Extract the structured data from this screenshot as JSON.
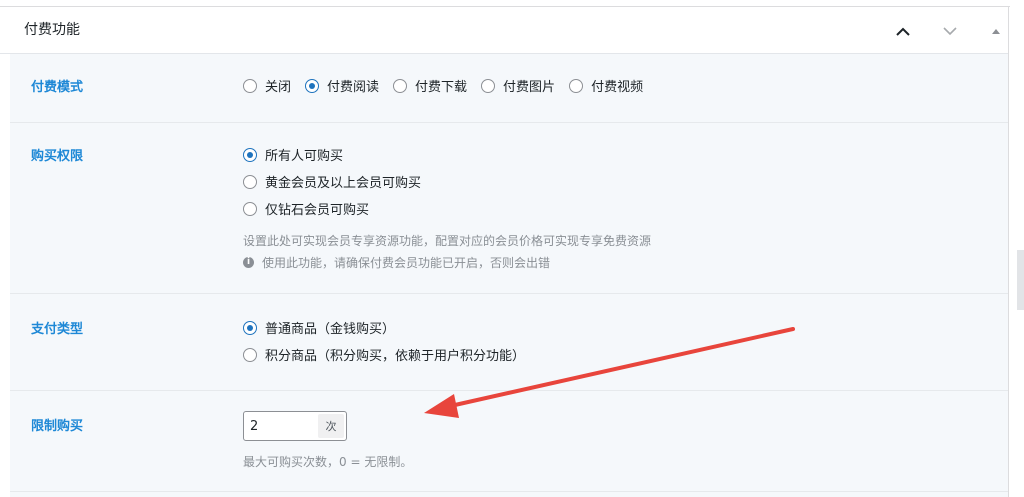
{
  "panel": {
    "title": "付费功能",
    "icons": [
      "chevron-up-icon",
      "chevron-down-icon",
      "triangle-up-icon"
    ],
    "colors": {
      "label": "#1e88d6",
      "radio_checked": "#1e73be",
      "background": "#f5f8fb",
      "annotation_arrow": "#e8453c"
    }
  },
  "pay_mode": {
    "label": "付费模式",
    "options": [
      "关闭",
      "付费阅读",
      "付费下载",
      "付费图片",
      "付费视频"
    ],
    "selected": "付费阅读"
  },
  "purchase_permission": {
    "label": "购买权限",
    "options": [
      "所有人可购买",
      "黄金会员及以上会员可购买",
      "仅钻石会员可购买"
    ],
    "selected": "所有人可购买",
    "description": "设置此处可实现会员专享资源功能，配置对应的会员价格可实现专享免费资源",
    "notice": "使用此功能，请确保付费会员功能已开启，否则会出错"
  },
  "payment_type": {
    "label": "支付类型",
    "options": [
      "普通商品（金钱购买）",
      "积分商品（积分购买，依赖于用户积分功能）"
    ],
    "selected": "普通商品（金钱购买）"
  },
  "purchase_limit": {
    "label": "限制购买",
    "value": "2",
    "unit": "次",
    "hint": "最大可购买次数，0 = 无限制。"
  }
}
